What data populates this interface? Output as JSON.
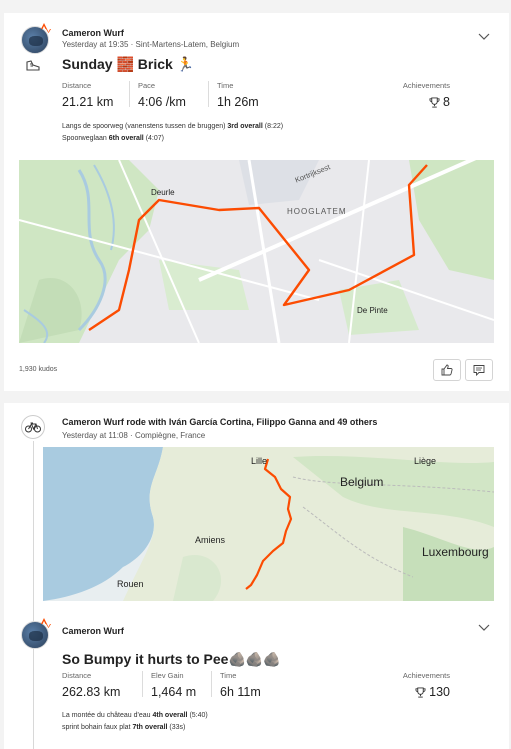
{
  "feed": [
    {
      "athlete": "Cameron Wurf",
      "meta": "Yesterday at 19:35 · Sint-Martens-Latem, Belgium",
      "title": "Sunday 🧱 Brick 🏃",
      "stats": [
        {
          "label": "Distance",
          "value": "21.21 km"
        },
        {
          "label": "Pace",
          "value": "4:06 /km"
        },
        {
          "label": "Time",
          "value": "1h 26m"
        }
      ],
      "achievements_label": "Achievements",
      "achievements_value": "8",
      "segments": [
        {
          "name": "Langs de spoorweg (vanenstens tussen de bruggen)",
          "rank": "3rd overall",
          "time": "(8:22)"
        },
        {
          "name": "Spoorweglaan",
          "rank": "6th overall",
          "time": "(4:07)"
        }
      ],
      "map_labels": {
        "deurle": "Deurle",
        "hooglatem": "HOOGLATEM",
        "depinte": "De Pinte",
        "kortrijk": "Kortrijksest"
      },
      "kudos": "1,930 kudos"
    },
    {
      "header": "Cameron Wurf rode with Iván García Cortina, Filippo Ganna and 49 others",
      "meta": "Yesterday at 11:08 · Compiègne, France",
      "map_labels": {
        "lille": "Lille",
        "liege": "Liège",
        "belgium": "Belgium",
        "amiens": "Amiens",
        "luxembourg": "Luxembourg",
        "rouen": "Rouen"
      },
      "athlete": "Cameron Wurf",
      "title": "So Bumpy it hurts to Pee🪨🪨🪨",
      "stats": [
        {
          "label": "Distance",
          "value": "262.83 km"
        },
        {
          "label": "Elev Gain",
          "value": "1,464 m"
        },
        {
          "label": "Time",
          "value": "6h 11m"
        }
      ],
      "achievements_label": "Achievements",
      "achievements_value": "130",
      "segments": [
        {
          "name": "La montée du château d'eau",
          "rank": "4th overall",
          "time": "(5:40)"
        },
        {
          "name": "sprint bohain faux plat",
          "rank": "7th overall",
          "time": "(33s)"
        }
      ]
    }
  ],
  "colors": {
    "route": "#fc4c02",
    "brand": "#fc4c02",
    "map_green": "#cfe6c3",
    "map_water": "#a9cbe0"
  }
}
